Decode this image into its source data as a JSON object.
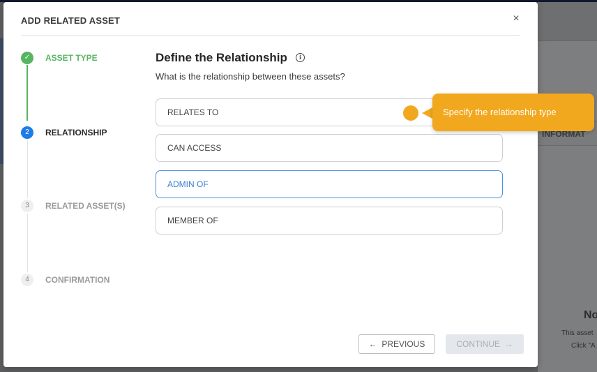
{
  "background": {
    "panel_tab_label": "INFORMAT",
    "empty_title": "No",
    "empty_line1": "This asset",
    "empty_line2": "Click \"A"
  },
  "modal": {
    "title": "ADD RELATED ASSET",
    "close_icon": "×"
  },
  "steps": [
    {
      "number": "✓",
      "label": "ASSET TYPE",
      "state": "complete"
    },
    {
      "number": "2",
      "label": "RELATIONSHIP",
      "state": "active"
    },
    {
      "number": "3",
      "label": "RELATED ASSET(S)",
      "state": "pending"
    },
    {
      "number": "4",
      "label": "CONFIRMATION",
      "state": "pending"
    }
  ],
  "content": {
    "title": "Define the Relationship",
    "info_icon": "i",
    "subtitle": "What is the relationship between these assets?",
    "options": [
      {
        "label": "RELATES TO",
        "selected": false
      },
      {
        "label": "CAN ACCESS",
        "selected": false
      },
      {
        "label": "ADMIN OF",
        "selected": true
      },
      {
        "label": "MEMBER OF",
        "selected": false
      }
    ]
  },
  "footer": {
    "previous_label": "PREVIOUS",
    "previous_arrow": "←",
    "continue_label": "CONTINUE",
    "continue_arrow": "→"
  },
  "tooltip": {
    "text": "Specify the relationship type",
    "color": "#f2a81e"
  },
  "colors": {
    "complete": "#57b561",
    "active": "#1f7be6",
    "selected_border": "#4a90e2"
  }
}
